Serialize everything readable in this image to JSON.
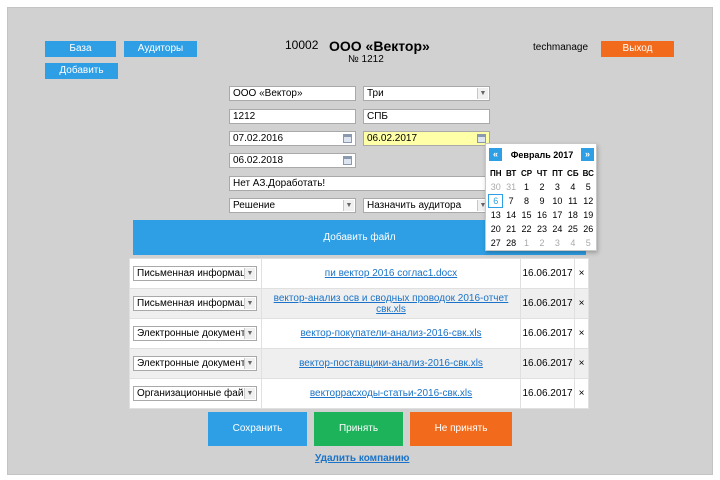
{
  "nav": {
    "base": "База",
    "auditors": "Аудиторы",
    "add": "Добавить",
    "logout": "Выход"
  },
  "header": {
    "id": "10002",
    "company": "ООО «Вектор»",
    "number": "№ 1212",
    "user": "techmanage"
  },
  "form": {
    "company_name": "ООО «Вектор»",
    "select_three": "Три",
    "code": "1212",
    "city": "СПБ",
    "date1": "07.02.2016",
    "date2": "06.02.2017",
    "date3": "06.02.2018",
    "comment": "Нет АЗ.Доработать!",
    "decision": "Решение",
    "assign_auditor": "Назначить аудитора"
  },
  "upload_label": "Добавить файл",
  "files": [
    {
      "type": "Письменная информац",
      "name": "пи вектор 2016 соглас1.docx",
      "date": "16.06.2017",
      "delete": "×"
    },
    {
      "type": "Письменная информац",
      "name": "вектор-анализ осв и сводных проводок 2016-отчет свк.xls",
      "date": "16.06.2017",
      "delete": "×"
    },
    {
      "type": "Электронные документ",
      "name": "вектор-покупатели-анализ-2016-свк.xls",
      "date": "16.06.2017",
      "delete": "×"
    },
    {
      "type": "Электронные документ",
      "name": "вектор-поставщики-анализ-2016-свк.xls",
      "date": "16.06.2017",
      "delete": "×"
    },
    {
      "type": "Организационные фай",
      "name": "векторрасходы-статьи-2016-свк.xls",
      "date": "16.06.2017",
      "delete": "×"
    }
  ],
  "actions": {
    "save": "Сохранить",
    "accept": "Принять",
    "reject": "Не принять",
    "delete_company": "Удалить компанию"
  },
  "colors": {
    "blue": "#2e9fe5",
    "green": "#1cb35a",
    "orange": "#f26b1d",
    "link": "#1a73c8",
    "highlight": "#ffffa8"
  },
  "calendar": {
    "prev": "«",
    "next": "»",
    "title": "Февраль 2017",
    "weekdays": [
      "ПН",
      "ВТ",
      "СР",
      "ЧТ",
      "ПТ",
      "СБ",
      "ВС"
    ],
    "weeks": [
      [
        "30",
        "31",
        "1",
        "2",
        "3",
        "4",
        "5"
      ],
      [
        "6",
        "7",
        "8",
        "9",
        "10",
        "11",
        "12"
      ],
      [
        "13",
        "14",
        "15",
        "16",
        "17",
        "18",
        "19"
      ],
      [
        "20",
        "21",
        "22",
        "23",
        "24",
        "25",
        "26"
      ],
      [
        "27",
        "28",
        "1",
        "2",
        "3",
        "4",
        "5"
      ]
    ]
  }
}
